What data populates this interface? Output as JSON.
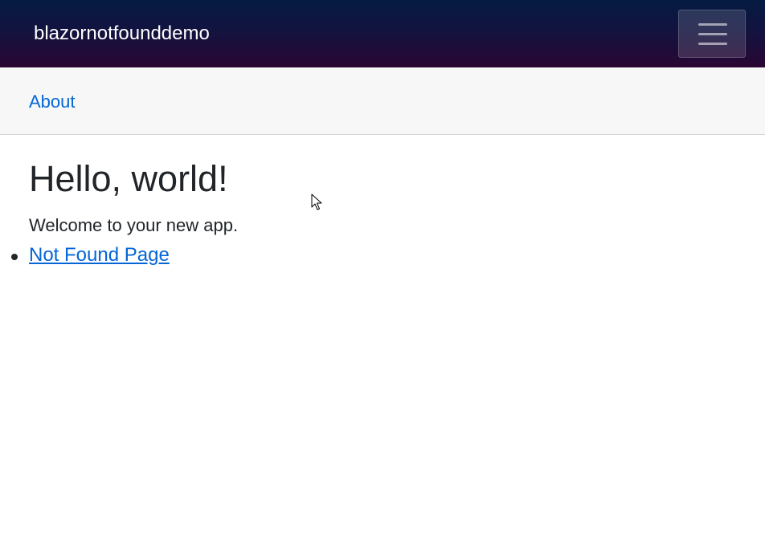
{
  "navbar": {
    "brand": "blazornotfounddemo",
    "toggler_icon": "hamburger-menu-icon"
  },
  "topbar": {
    "about_label": "About"
  },
  "main": {
    "title": "Hello, world!",
    "welcome_text": "Welcome to your new app.",
    "links": [
      {
        "label": "Not Found Page"
      }
    ]
  },
  "colors": {
    "nav_gradient_top": "#051b43",
    "nav_gradient_bottom": "#2a0634",
    "link": "#0366d6",
    "topbar_bg": "#f7f7f7"
  },
  "icons": {
    "cursor": "mouse-pointer-icon"
  }
}
